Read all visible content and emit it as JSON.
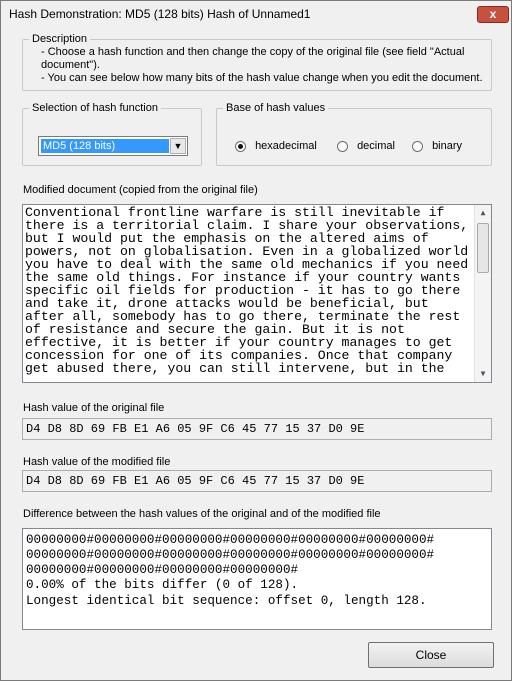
{
  "window": {
    "title": "Hash Demonstration: MD5 (128 bits) Hash of Unnamed1",
    "close_glyph": "x"
  },
  "description": {
    "legend": "Description",
    "lines": [
      "-  Choose a hash function and then change the copy of the original file (see field \"Actual",
      "   document\").",
      "-  You can see below how many bits of the hash value change when you edit the document."
    ]
  },
  "hash_function": {
    "legend": "Selection of hash function",
    "selected": "MD5 (128 bits)"
  },
  "base": {
    "legend": "Base of hash values",
    "options": [
      {
        "label": "hexadecimal",
        "checked": true
      },
      {
        "label": "decimal",
        "checked": false
      },
      {
        "label": "binary",
        "checked": false
      }
    ]
  },
  "document": {
    "label": "Modified document (copied from the original file)",
    "lines": [
      "Conventional frontline warfare is still inevitable if",
      "there is a territorial claim. I share your observations,",
      "but I would put the emphasis on the altered aims of",
      "powers, not on globalisation. Even in a globalized world",
      "you have to deal with the same old mechanics if you need",
      "the same old things. For instance if your country wants",
      "specific oil fields for production - it has to go there",
      "and take it, drone attacks would be beneficial, but",
      "after all, somebody has to go there, terminate the rest",
      "of resistance and secure the gain. But it is not",
      "effective, it is better if your country manages to get",
      "concession for one of its companies. Once that company",
      "get abused there, you can still intervene, but in the"
    ]
  },
  "original_hash": {
    "label": "Hash value of the original file",
    "value": "D4 D8 8D 69 FB E1 A6 05 9F C6 45 77 15 37 D0 9E"
  },
  "modified_hash": {
    "label": "Hash value of the modified file",
    "value": "D4 D8 8D 69 FB E1 A6 05 9F C6 45 77 15 37 D0 9E"
  },
  "difference": {
    "label": "Difference between the hash values of the original and of the modified file",
    "lines": [
      "00000000#00000000#00000000#00000000#00000000#00000000#",
      "00000000#00000000#00000000#00000000#00000000#00000000#",
      "00000000#00000000#00000000#00000000#",
      "0.00% of the bits differ (0 of 128).",
      "Longest identical bit sequence: offset 0, length 128."
    ]
  },
  "buttons": {
    "close": "Close"
  }
}
